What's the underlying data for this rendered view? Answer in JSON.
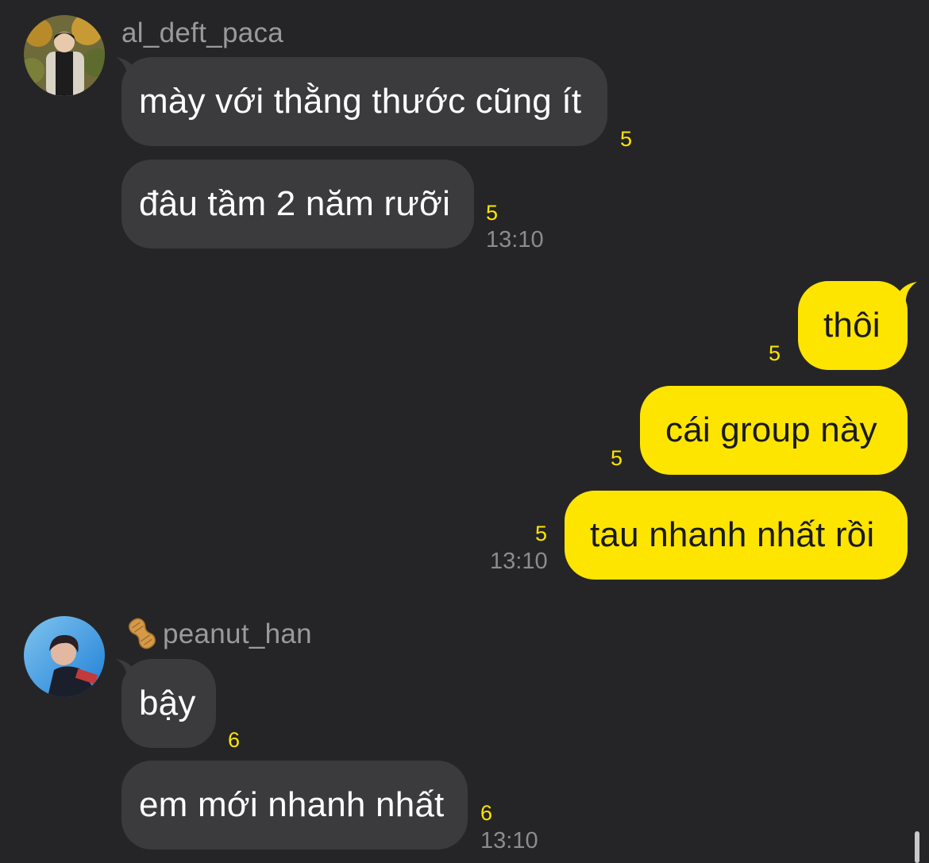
{
  "messages": [
    {
      "sender": "al_deft_paca",
      "direction": "incoming",
      "bubbles": [
        {
          "text": "mày với thằng thước cũng ít",
          "unread": "5"
        },
        {
          "text": "đâu tầm 2 năm rưỡi",
          "unread": "5",
          "time": "13:10"
        }
      ]
    },
    {
      "direction": "outgoing",
      "bubbles": [
        {
          "text": "thôi",
          "unread": "5"
        },
        {
          "text": "cái group này",
          "unread": "5"
        },
        {
          "text": "tau nhanh nhất rồi",
          "unread": "5",
          "time": "13:10"
        }
      ]
    },
    {
      "sender": "peanut_han",
      "sender_prefix_icon": "peanut-icon",
      "direction": "incoming",
      "bubbles": [
        {
          "text": "bậy",
          "unread": "6"
        },
        {
          "text": "em mới nhanh nhất",
          "unread": "6",
          "time": "13:10"
        }
      ]
    }
  ],
  "colors": {
    "background": "#252527",
    "incoming_bubble": "#3b3b3e",
    "outgoing_bubble": "#fee500",
    "unread_count": "#fee500",
    "sender_name": "#9a9a9c",
    "timestamp": "#8c8c8e"
  }
}
